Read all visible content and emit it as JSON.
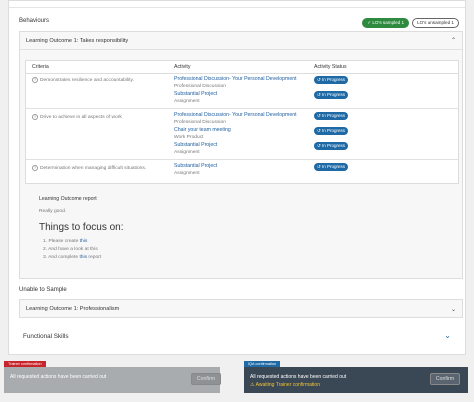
{
  "behaviours": {
    "title": "Behaviours",
    "badge_sampled": "✓ LO's sampled 1",
    "badge_unsampled": "LO's unsampled 1"
  },
  "outcome1": {
    "title": "Learning Outcome 1: Takes responsibility",
    "columns": [
      "Criteria",
      "Activity",
      "Activity Status"
    ],
    "rows": [
      {
        "criteria": "Demonstrates resilience and accountability.",
        "activities": [
          {
            "name": "Professional Discussion- Your Personal Development",
            "type": "Professional Discussion",
            "status": "↺ In Progress"
          },
          {
            "name": "Substantial Project",
            "type": "Assignment",
            "status": "↺ In Progress"
          }
        ]
      },
      {
        "criteria": "Drive to achieve in all aspects of work",
        "activities": [
          {
            "name": "Professional Discussion- Your Personal Development",
            "type": "Professional Discussion",
            "status": "↺ In Progress"
          },
          {
            "name": "Chair your team meeting",
            "type": "Work Product",
            "status": "↺ In Progress"
          },
          {
            "name": "Substantial Project",
            "type": "Assignment",
            "status": "↺ In Progress"
          }
        ]
      },
      {
        "criteria": "Determination when managing difficult situations.",
        "activities": [
          {
            "name": "Substantial Project",
            "type": "Assignment",
            "status": "↺ In Progress"
          }
        ]
      }
    ],
    "report_label": "Learning Outcome report",
    "report_text": "Really good.",
    "focus_title": "Things to focus on:",
    "focus_items": [
      {
        "pre": "1. Please create ",
        "link": "this",
        "post": ""
      },
      {
        "pre": "2. And have a look at this",
        "link": "",
        "post": ""
      },
      {
        "pre": "3. And complete ",
        "link": "this",
        "post": " report"
      }
    ]
  },
  "unable": {
    "title": "Unable to Sample",
    "outcome_title": "Learning Outcome 1: Professionalism"
  },
  "functional": {
    "title": "Functional Skills"
  },
  "trainer": {
    "tag": "Trainer confirmation",
    "message": "All requested actions have been carried out",
    "button": "Confirm"
  },
  "iqa": {
    "tag": "IQA confirmation",
    "message": "All requested actions have been carried out",
    "warning": "⚠ Awaiting Trainer confirmation",
    "button": "Confirm"
  }
}
